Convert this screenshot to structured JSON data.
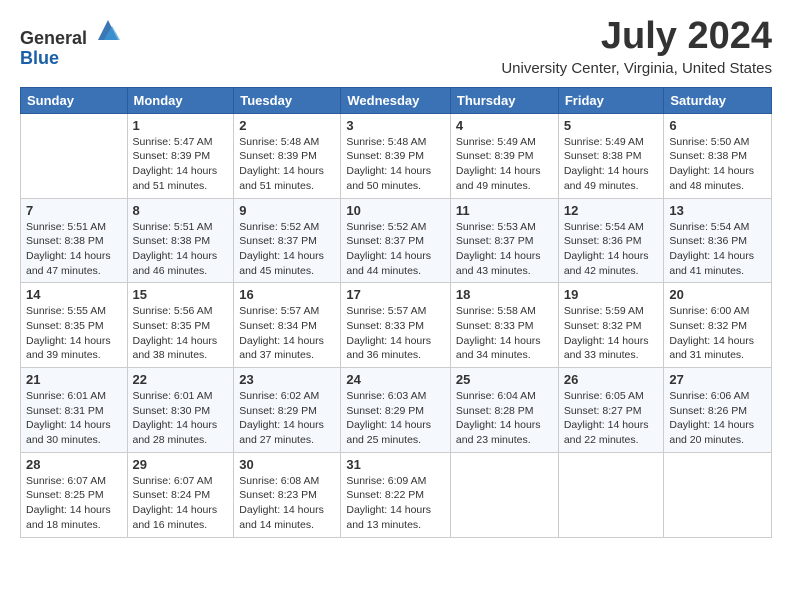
{
  "header": {
    "logo": {
      "text_general": "General",
      "text_blue": "Blue"
    },
    "title": "July 2024",
    "subtitle": "University Center, Virginia, United States"
  },
  "calendar": {
    "days_of_week": [
      "Sunday",
      "Monday",
      "Tuesday",
      "Wednesday",
      "Thursday",
      "Friday",
      "Saturday"
    ],
    "weeks": [
      [
        {
          "day": "",
          "info": ""
        },
        {
          "day": "1",
          "info": "Sunrise: 5:47 AM\nSunset: 8:39 PM\nDaylight: 14 hours\nand 51 minutes."
        },
        {
          "day": "2",
          "info": "Sunrise: 5:48 AM\nSunset: 8:39 PM\nDaylight: 14 hours\nand 51 minutes."
        },
        {
          "day": "3",
          "info": "Sunrise: 5:48 AM\nSunset: 8:39 PM\nDaylight: 14 hours\nand 50 minutes."
        },
        {
          "day": "4",
          "info": "Sunrise: 5:49 AM\nSunset: 8:39 PM\nDaylight: 14 hours\nand 49 minutes."
        },
        {
          "day": "5",
          "info": "Sunrise: 5:49 AM\nSunset: 8:38 PM\nDaylight: 14 hours\nand 49 minutes."
        },
        {
          "day": "6",
          "info": "Sunrise: 5:50 AM\nSunset: 8:38 PM\nDaylight: 14 hours\nand 48 minutes."
        }
      ],
      [
        {
          "day": "7",
          "info": "Sunrise: 5:51 AM\nSunset: 8:38 PM\nDaylight: 14 hours\nand 47 minutes."
        },
        {
          "day": "8",
          "info": "Sunrise: 5:51 AM\nSunset: 8:38 PM\nDaylight: 14 hours\nand 46 minutes."
        },
        {
          "day": "9",
          "info": "Sunrise: 5:52 AM\nSunset: 8:37 PM\nDaylight: 14 hours\nand 45 minutes."
        },
        {
          "day": "10",
          "info": "Sunrise: 5:52 AM\nSunset: 8:37 PM\nDaylight: 14 hours\nand 44 minutes."
        },
        {
          "day": "11",
          "info": "Sunrise: 5:53 AM\nSunset: 8:37 PM\nDaylight: 14 hours\nand 43 minutes."
        },
        {
          "day": "12",
          "info": "Sunrise: 5:54 AM\nSunset: 8:36 PM\nDaylight: 14 hours\nand 42 minutes."
        },
        {
          "day": "13",
          "info": "Sunrise: 5:54 AM\nSunset: 8:36 PM\nDaylight: 14 hours\nand 41 minutes."
        }
      ],
      [
        {
          "day": "14",
          "info": "Sunrise: 5:55 AM\nSunset: 8:35 PM\nDaylight: 14 hours\nand 39 minutes."
        },
        {
          "day": "15",
          "info": "Sunrise: 5:56 AM\nSunset: 8:35 PM\nDaylight: 14 hours\nand 38 minutes."
        },
        {
          "day": "16",
          "info": "Sunrise: 5:57 AM\nSunset: 8:34 PM\nDaylight: 14 hours\nand 37 minutes."
        },
        {
          "day": "17",
          "info": "Sunrise: 5:57 AM\nSunset: 8:33 PM\nDaylight: 14 hours\nand 36 minutes."
        },
        {
          "day": "18",
          "info": "Sunrise: 5:58 AM\nSunset: 8:33 PM\nDaylight: 14 hours\nand 34 minutes."
        },
        {
          "day": "19",
          "info": "Sunrise: 5:59 AM\nSunset: 8:32 PM\nDaylight: 14 hours\nand 33 minutes."
        },
        {
          "day": "20",
          "info": "Sunrise: 6:00 AM\nSunset: 8:32 PM\nDaylight: 14 hours\nand 31 minutes."
        }
      ],
      [
        {
          "day": "21",
          "info": "Sunrise: 6:01 AM\nSunset: 8:31 PM\nDaylight: 14 hours\nand 30 minutes."
        },
        {
          "day": "22",
          "info": "Sunrise: 6:01 AM\nSunset: 8:30 PM\nDaylight: 14 hours\nand 28 minutes."
        },
        {
          "day": "23",
          "info": "Sunrise: 6:02 AM\nSunset: 8:29 PM\nDaylight: 14 hours\nand 27 minutes."
        },
        {
          "day": "24",
          "info": "Sunrise: 6:03 AM\nSunset: 8:29 PM\nDaylight: 14 hours\nand 25 minutes."
        },
        {
          "day": "25",
          "info": "Sunrise: 6:04 AM\nSunset: 8:28 PM\nDaylight: 14 hours\nand 23 minutes."
        },
        {
          "day": "26",
          "info": "Sunrise: 6:05 AM\nSunset: 8:27 PM\nDaylight: 14 hours\nand 22 minutes."
        },
        {
          "day": "27",
          "info": "Sunrise: 6:06 AM\nSunset: 8:26 PM\nDaylight: 14 hours\nand 20 minutes."
        }
      ],
      [
        {
          "day": "28",
          "info": "Sunrise: 6:07 AM\nSunset: 8:25 PM\nDaylight: 14 hours\nand 18 minutes."
        },
        {
          "day": "29",
          "info": "Sunrise: 6:07 AM\nSunset: 8:24 PM\nDaylight: 14 hours\nand 16 minutes."
        },
        {
          "day": "30",
          "info": "Sunrise: 6:08 AM\nSunset: 8:23 PM\nDaylight: 14 hours\nand 14 minutes."
        },
        {
          "day": "31",
          "info": "Sunrise: 6:09 AM\nSunset: 8:22 PM\nDaylight: 14 hours\nand 13 minutes."
        },
        {
          "day": "",
          "info": ""
        },
        {
          "day": "",
          "info": ""
        },
        {
          "day": "",
          "info": ""
        }
      ]
    ]
  }
}
